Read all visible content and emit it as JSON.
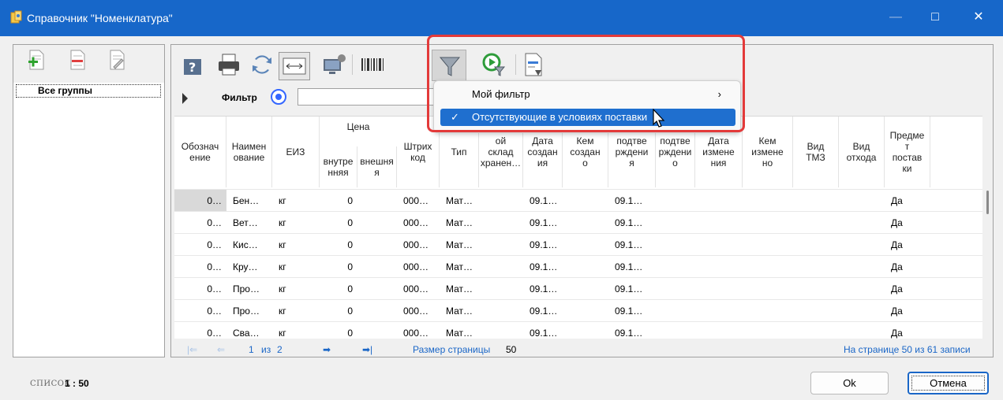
{
  "window": {
    "title": "Справочник \"Номенклатура\"",
    "minimize_glyph": "—",
    "maximize_glyph": "□",
    "close_glyph": "✕",
    "titlebar_color": "#1767c9"
  },
  "left_panel": {
    "root_group": "Все группы",
    "icons": [
      "add-group-icon",
      "delete-group-icon",
      "edit-group-icon"
    ]
  },
  "toolbar": {
    "icons": [
      "help-icon",
      "print-icon",
      "refresh-icon",
      "column-width-icon",
      "settings-computer-icon",
      "barcode-icon",
      "filter-icon",
      "run-filter-icon",
      "export-document-icon"
    ]
  },
  "filter": {
    "label": "Фильтр",
    "value": ""
  },
  "dropdown": {
    "items": [
      {
        "label": "Мой фильтр",
        "checked": false,
        "submenu_glyph": "›"
      },
      {
        "label": "Отсутствующие в условиях поставки",
        "checked": true,
        "check_glyph": "✓"
      }
    ],
    "highlight_color": "#1f6fcf",
    "annotation_color": "#e33a3a"
  },
  "grid": {
    "price_group": "Цена",
    "columns": [
      "Обозначение",
      "Наименование",
      "ЕИЗ",
      "внутренняя",
      "внешняя",
      "Штрих код",
      "Тип",
      "ой склад хранен…",
      "Дата создания",
      "Кем создано",
      "подтверждения",
      "подтверждено",
      "Дата изменения",
      "Кем изменено",
      "Вид ТМЗ",
      "Вид отхода",
      "Предмет поставки"
    ],
    "column_header_labels": [
      "Обознач\nение",
      "Наимен\nование",
      "ЕИЗ",
      "внутре\nнняя",
      "внешня\nя",
      "Штрих\nкод",
      "Тип",
      "ой\nсклад\nхранен…",
      "Дата\nсоздан\nия",
      "Кем\nсоздан\nо",
      "подтве\nрждени\nя",
      "подтве\nрждени\nо",
      "Дата\nизмене\nния",
      "Кем\nизмене\nно",
      "Вид\nТМЗ",
      "Вид\nотхода",
      "Предме\nт\nпостав\nки"
    ],
    "rows": [
      [
        "0…",
        "Бен…",
        "кг",
        "0",
        "000…",
        "Мат…",
        "09.1…",
        "09.1…",
        "Да"
      ],
      [
        "0…",
        "Вет…",
        "кг",
        "0",
        "000…",
        "Мат…",
        "09.1…",
        "09.1…",
        "Да"
      ],
      [
        "0…",
        "Кис…",
        "кг",
        "0",
        "000…",
        "Мат…",
        "09.1…",
        "09.1…",
        "Да"
      ],
      [
        "0…",
        "Кру…",
        "кг",
        "0",
        "000…",
        "Мат…",
        "09.1…",
        "09.1…",
        "Да"
      ],
      [
        "0…",
        "Про…",
        "кг",
        "0",
        "000…",
        "Мат…",
        "09.1…",
        "09.1…",
        "Да"
      ],
      [
        "0…",
        "Про…",
        "кг",
        "0",
        "000…",
        "Мат…",
        "09.1…",
        "09.1…",
        "Да"
      ],
      [
        "0…",
        "Сва…",
        "кг",
        "0",
        "000…",
        "Мат…",
        "09.1…",
        "09.1…",
        "Да"
      ]
    ]
  },
  "pager": {
    "first_glyph": "|⇐",
    "prev_glyph": "⇐",
    "current_page": "1",
    "of_label": "из",
    "total_pages": "2",
    "next_glyph": "➡",
    "last_glyph": "➡|",
    "page_size_label": "Размер страницы",
    "page_size": "50",
    "records_info": "На странице 50 из 61 записи"
  },
  "footer": {
    "mode": "СПИСОК",
    "scale": "1 : 50",
    "ok_label": "Ok",
    "cancel_label": "Отмена"
  }
}
